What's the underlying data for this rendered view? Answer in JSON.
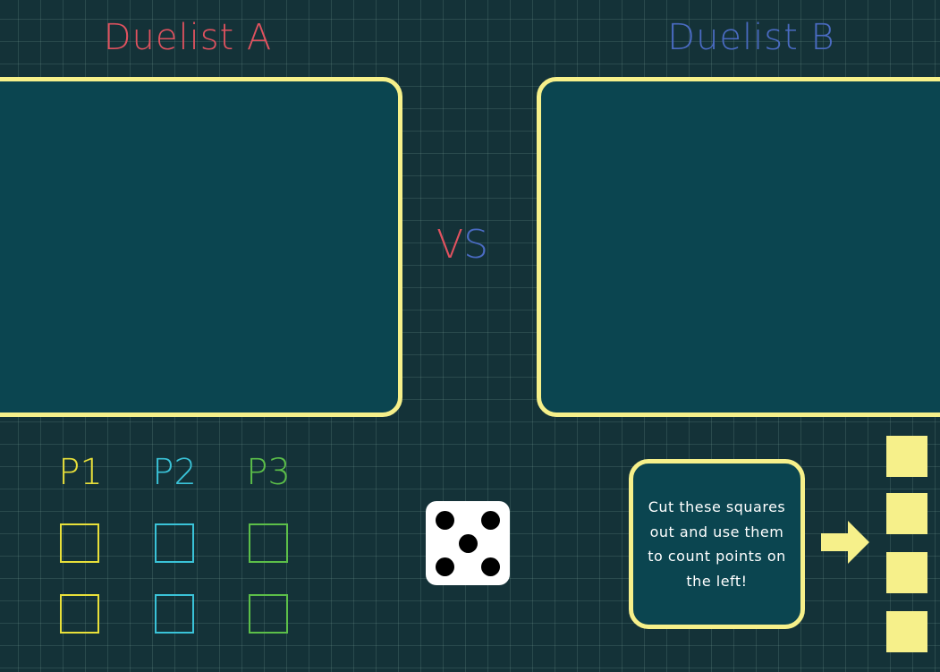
{
  "players": {
    "a": {
      "name": "Duelist A",
      "color": "#e0525f"
    },
    "b": {
      "name": "Duelist B",
      "color": "#4a6bc2"
    }
  },
  "versus": {
    "v": "V",
    "s": "S"
  },
  "point_columns": [
    {
      "label": "P1",
      "color": "#e8e03a"
    },
    {
      "label": "P2",
      "color": "#3ac3d8"
    },
    {
      "label": "P3",
      "color": "#5cbf49"
    }
  ],
  "die": {
    "face_value": 5
  },
  "instructions": {
    "text": "Cut these squares out and use them to count points on the left!"
  },
  "tokens": {
    "count": 4,
    "color": "#f6f08a"
  },
  "colors": {
    "background": "#143238",
    "card_fill": "#0b4550",
    "frame": "#f6f08a"
  }
}
